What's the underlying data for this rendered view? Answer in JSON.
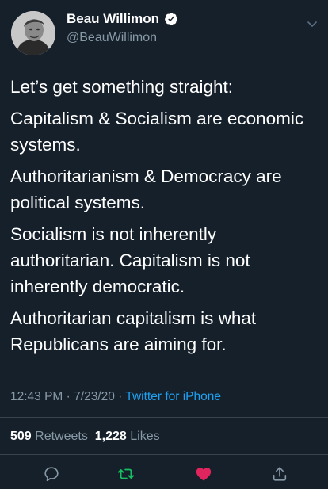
{
  "author": {
    "display_name": "Beau Willimon",
    "handle": "@BeauWillimon",
    "verified_icon": "verified-badge-icon",
    "avatar_icon": "avatar-photo"
  },
  "tweet": {
    "paragraphs": [
      "Let’s get something straight:",
      "Capitalism & Socialism are economic systems.",
      "Authoritarianism & Democracy are political systems.",
      "Socialism is not inherently authoritarian. Capitalism is not inherently democratic.",
      "Authoritarian capitalism is what Republicans are aiming for."
    ],
    "time": "12:43 PM",
    "date": "7/23/20",
    "source": "Twitter for iPhone"
  },
  "stats": {
    "retweets_count": "509",
    "retweets_label": "Retweets",
    "likes_count": "1,228",
    "likes_label": "Likes"
  },
  "actions": {
    "reply_icon": "reply-icon",
    "retweet_icon": "retweet-icon",
    "like_icon": "heart-icon",
    "share_icon": "share-icon"
  },
  "colors": {
    "background": "#15202b",
    "secondary_text": "#8899a6",
    "link": "#1da1f2",
    "retweet_green": "#17bf63",
    "like_red": "#e0245e",
    "divider": "#38444d"
  }
}
